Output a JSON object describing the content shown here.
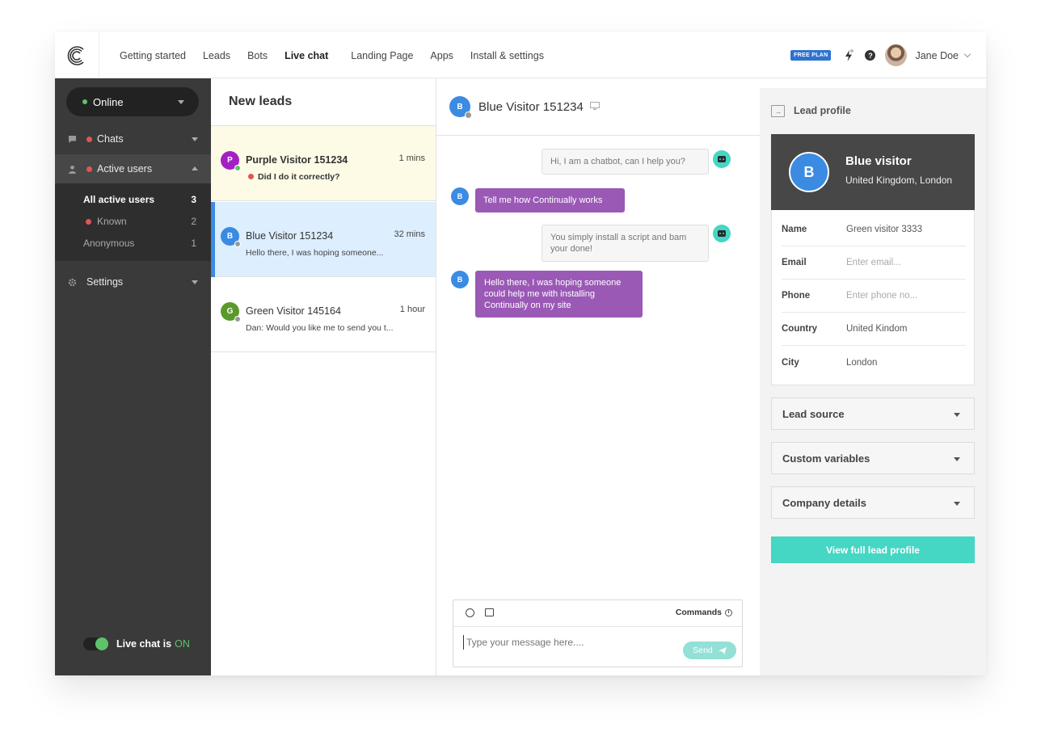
{
  "brand": {
    "accent": "#45d6c4",
    "online": "#5ec26a",
    "alert": "#e05656",
    "visitor_bubble": "#9b59b6"
  },
  "nav": {
    "items": [
      "Getting started",
      "Leads",
      "Bots",
      "Live chat",
      "Landing Page",
      "Apps",
      "Install & settings"
    ],
    "active": "Live chat"
  },
  "topbar": {
    "plan_badge": "FREE PLAN",
    "user_name": "Jane Doe"
  },
  "sidebar": {
    "status": "Online",
    "chats_label": "Chats",
    "active_users_label": "Active users",
    "subitems": [
      {
        "label": "All active users",
        "count": "3"
      },
      {
        "label": "Known",
        "count": "2"
      },
      {
        "label": "Anonymous",
        "count": "1"
      }
    ],
    "settings_label": "Settings",
    "live_chat_prefix": "Live chat is",
    "live_chat_state": "ON"
  },
  "leads": {
    "title": "New leads",
    "items": [
      {
        "initial": "P",
        "name": "Purple Visitor 151234",
        "time": "1 mins",
        "message": "Did I do it correctly?"
      },
      {
        "initial": "B",
        "name": "Blue Visitor 151234",
        "time": "32 mins",
        "message": "Hello there, I was hoping someone..."
      },
      {
        "initial": "G",
        "name": "Green Visitor 145164",
        "time": "1 hour",
        "message": "Dan: Would you like me to send you t..."
      }
    ]
  },
  "chat": {
    "title": "Blue Visitor 151234",
    "avatar_initial": "B",
    "messages": [
      {
        "from": "bot",
        "text": "Hi, I am a chatbot, can I help you?"
      },
      {
        "from": "visitor",
        "text": "Tell me how Continually works"
      },
      {
        "from": "bot",
        "text": "You simply install a script and bam your done!"
      },
      {
        "from": "visitor",
        "text": "Hello there, I was hoping someone could help me with installing Continually on my site"
      }
    ],
    "commands_label": "Commands",
    "input_placeholder": "Type your message here....",
    "send_label": "Send"
  },
  "profile": {
    "title": "Lead profile",
    "initial": "B",
    "name": "Blue visitor",
    "location": "United Kingdom, London",
    "fields": [
      {
        "key": "Name",
        "value": "Green visitor 3333"
      },
      {
        "key": "Email",
        "value": "Enter email..."
      },
      {
        "key": "Phone",
        "value": "Enter phone no..."
      },
      {
        "key": "Country",
        "value": "United Kindom"
      },
      {
        "key": "City",
        "value": "London"
      }
    ],
    "sections": [
      "Lead source",
      "Custom variables",
      "Company details"
    ],
    "cta": "View full lead profile"
  }
}
